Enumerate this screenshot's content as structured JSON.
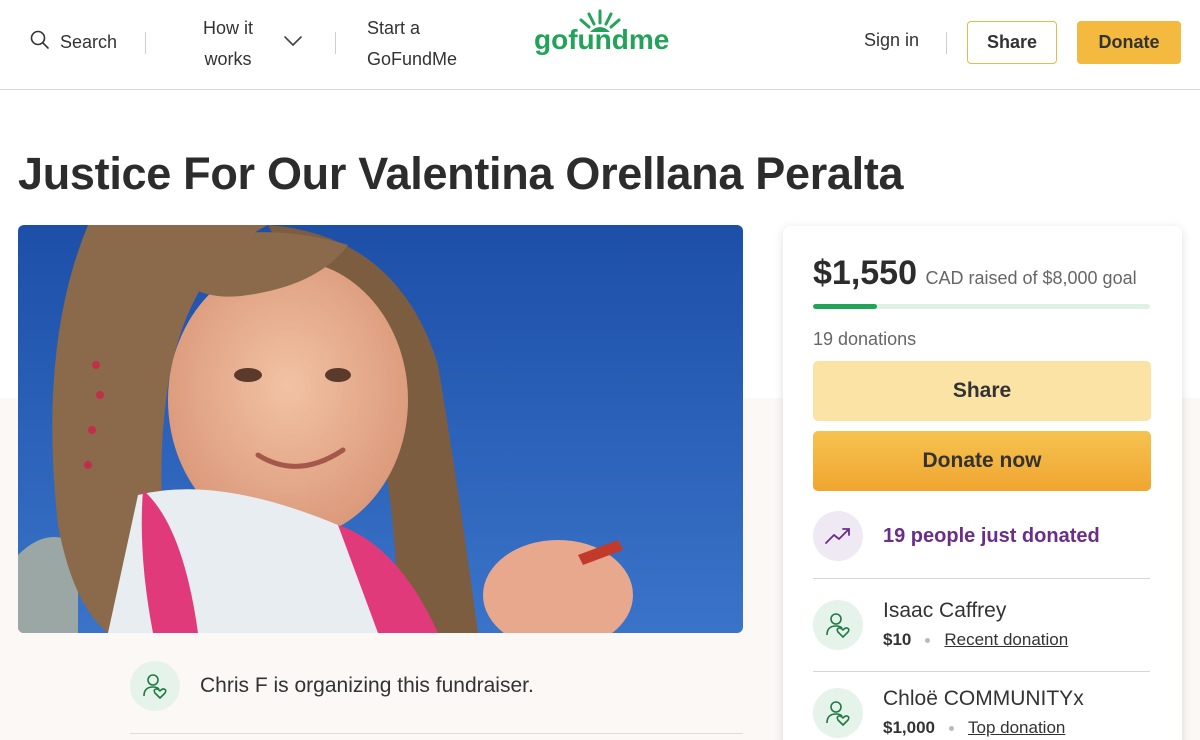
{
  "header": {
    "search_label": "Search",
    "how_it_works_line1": "How it",
    "how_it_works_line2": "works",
    "start_line1": "Start a",
    "start_line2": "GoFundMe",
    "logo_text": "gofundme",
    "sign_in": "Sign in",
    "share_label": "Share",
    "donate_label": "Donate"
  },
  "campaign": {
    "title": "Justice For Our Valentina Orellana Peralta",
    "organizer_text": "Chris F is organizing this fundraiser."
  },
  "card": {
    "raised_amount": "$1,550",
    "raised_rest": "CAD raised of $8,000 goal",
    "progress_fraction": 0.19,
    "donation_count": "19 donations",
    "share_label": "Share",
    "donate_label": "Donate now",
    "trend_text": "19 people just donated",
    "donors": [
      {
        "name": "Isaac Caffrey",
        "amount": "$10",
        "tag": "Recent donation"
      },
      {
        "name": "Chloë COMMUNITYx",
        "amount": "$1,000",
        "tag": "Top donation"
      }
    ]
  },
  "colors": {
    "brand_green": "#23a35a",
    "donate_orange": "#f4b93f",
    "trend_purple": "#6b2c8a"
  }
}
